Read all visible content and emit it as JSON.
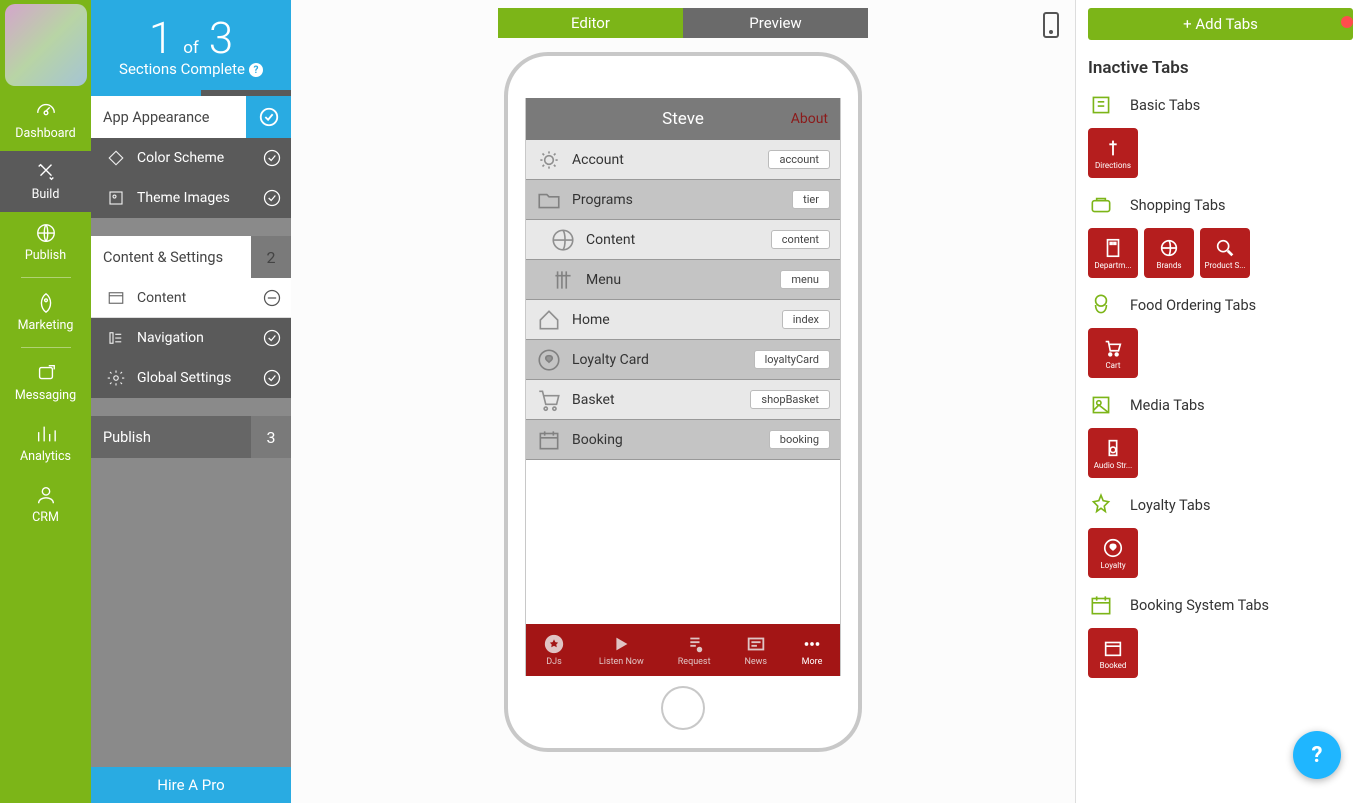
{
  "leftnav": {
    "items": [
      {
        "label": "Dashboard"
      },
      {
        "label": "Build"
      },
      {
        "label": "Publish"
      },
      {
        "label": "Marketing"
      },
      {
        "label": "Messaging"
      },
      {
        "label": "Analytics"
      },
      {
        "label": "CRM"
      }
    ]
  },
  "progress": {
    "current": "1",
    "of": "of",
    "total": "3",
    "subtitle": "Sections Complete"
  },
  "sections": {
    "appearance": {
      "title": "App Appearance",
      "items": [
        "Color Scheme",
        "Theme Images"
      ]
    },
    "content": {
      "title": "Content & Settings",
      "badge": "2",
      "items": [
        "Content",
        "Navigation",
        "Global Settings"
      ]
    },
    "publish": {
      "title": "Publish",
      "badge": "3"
    }
  },
  "hirepro": "Hire A Pro",
  "centertabs": {
    "editor": "Editor",
    "preview": "Preview"
  },
  "phone": {
    "title": "Steve",
    "about": "About",
    "rows": [
      {
        "label": "Account",
        "tag": "account",
        "alt": false
      },
      {
        "label": "Programs",
        "tag": "tier",
        "alt": true
      },
      {
        "label": "Content",
        "tag": "content",
        "alt": false,
        "indent": true
      },
      {
        "label": "Menu",
        "tag": "menu",
        "alt": true,
        "indent": true
      },
      {
        "label": "Home",
        "tag": "index",
        "alt": false
      },
      {
        "label": "Loyalty Card",
        "tag": "loyaltyCard",
        "alt": true
      },
      {
        "label": "Basket",
        "tag": "shopBasket",
        "alt": false
      },
      {
        "label": "Booking",
        "tag": "booking",
        "alt": true
      }
    ],
    "tabbar": [
      {
        "label": "DJs"
      },
      {
        "label": "Listen Now"
      },
      {
        "label": "Request"
      },
      {
        "label": "News"
      },
      {
        "label": "More"
      }
    ]
  },
  "right": {
    "addtabs": "+ Add Tabs",
    "title": "Inactive Tabs",
    "cats": [
      {
        "label": "Basic Tabs",
        "tiles": [
          {
            "label": "Directions"
          }
        ]
      },
      {
        "label": "Shopping Tabs",
        "tiles": [
          {
            "label": "Departm..."
          },
          {
            "label": "Brands"
          },
          {
            "label": "Product S..."
          }
        ]
      },
      {
        "label": "Food Ordering Tabs",
        "tiles": [
          {
            "label": "Cart"
          }
        ]
      },
      {
        "label": "Media Tabs",
        "tiles": [
          {
            "label": "Audio Str..."
          }
        ]
      },
      {
        "label": "Loyalty Tabs",
        "tiles": [
          {
            "label": "Loyalty"
          }
        ]
      },
      {
        "label": "Booking System Tabs",
        "tiles": [
          {
            "label": "Booked"
          }
        ]
      }
    ]
  }
}
